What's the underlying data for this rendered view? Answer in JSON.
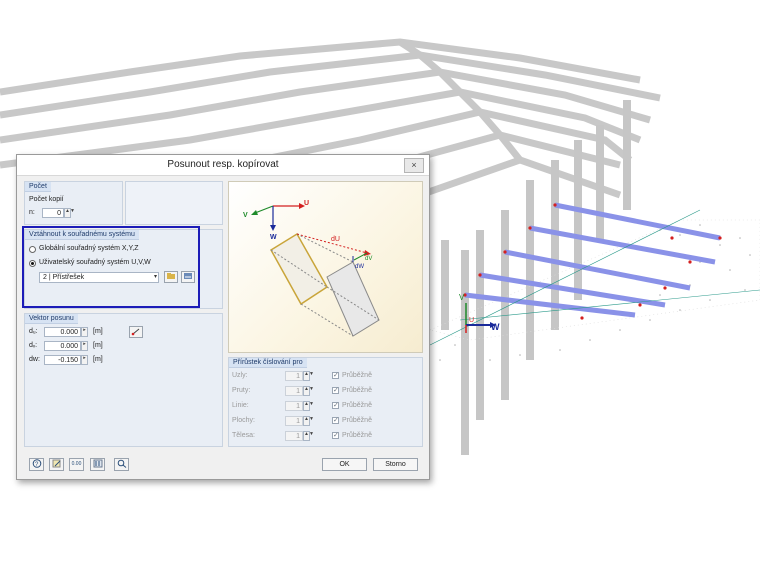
{
  "dialog": {
    "title": "Posunout resp. kopírovat",
    "close_label": "×"
  },
  "pocet": {
    "group_title": "Počet",
    "label": "Počet kopií",
    "n_label": "n:",
    "n_value": "0"
  },
  "system": {
    "group_title": "Vztáhnout k souřadnému systému",
    "option_global": "Globální souřadný systém X,Y,Z",
    "option_user": "Uživatelský souřadný systém U,V,W",
    "selected": "user",
    "combo_value": "2 | Přístřešek"
  },
  "vector": {
    "group_title": "Vektor posunu",
    "rows": [
      {
        "label": "dᵤ:",
        "value": "0.000",
        "unit": "[m]"
      },
      {
        "label": "dᵥ:",
        "value": "0.000",
        "unit": "[m]"
      },
      {
        "label": "dw:",
        "value": "-0.150",
        "unit": "[m]"
      }
    ]
  },
  "diagram": {
    "axis_v": "V",
    "axis_u": "U",
    "axis_w": "W",
    "d_u": "dU",
    "d_v": "dV",
    "d_w": "dW"
  },
  "increment": {
    "group_title": "Přírůstek číslování pro",
    "rows": [
      {
        "label": "Uzly:",
        "value": "1",
        "check_label": "Průběžně",
        "checked": true
      },
      {
        "label": "Pruty:",
        "value": "1",
        "check_label": "Průběžně",
        "checked": true
      },
      {
        "label": "Linie:",
        "value": "1",
        "check_label": "Průběžně",
        "checked": true
      },
      {
        "label": "Plochy:",
        "value": "1",
        "check_label": "Průběžně",
        "checked": true
      },
      {
        "label": "Tělesa:",
        "value": "1",
        "check_label": "Průběžně",
        "checked": true
      }
    ]
  },
  "footer": {
    "ok_label": "OK",
    "cancel_label": "Storno",
    "tool_values": [
      "0.00"
    ]
  },
  "scene_axes": {
    "v": "V",
    "w": "W",
    "u": "U"
  },
  "colors": {
    "focus_frame": "#1c1cb8",
    "axis_u_red": "#d42020",
    "axis_vw_blue": "#1a2a9a",
    "axis_green": "#1e8a2a",
    "purlin_blue": "#8a92e8",
    "frame_gray": "#c6c6c6"
  }
}
